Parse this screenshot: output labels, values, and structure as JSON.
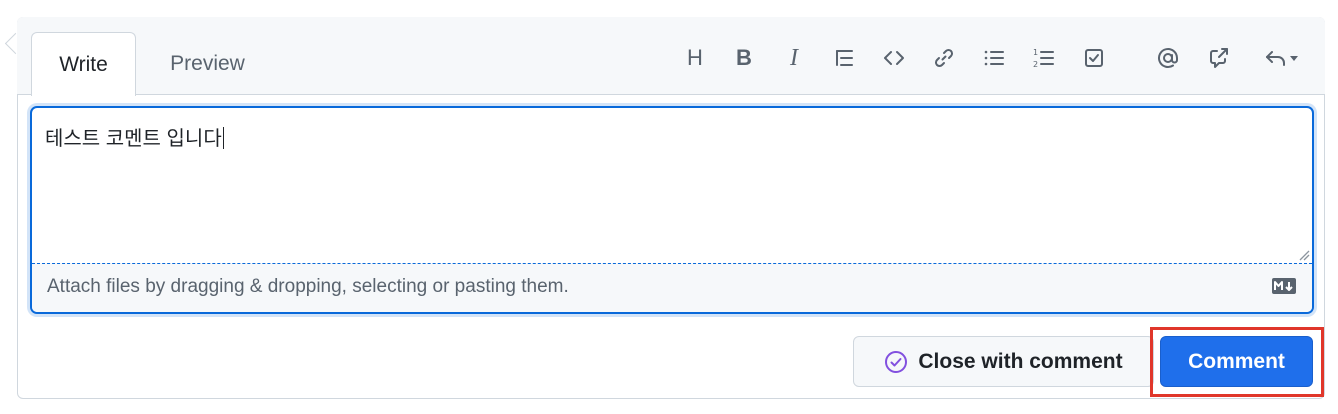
{
  "tabs": {
    "write": "Write",
    "preview": "Preview"
  },
  "toolbar": {
    "heading_glyph": "H",
    "bold_glyph": "B",
    "italic_glyph": "I",
    "items": [
      "heading-icon",
      "bold-icon",
      "italic-icon",
      "quote-icon",
      "code-icon",
      "link-icon",
      "unordered-list-icon",
      "ordered-list-icon",
      "task-list-icon",
      "mention-icon",
      "reference-icon",
      "reply-icon"
    ]
  },
  "editor": {
    "value": "테스트 코멘트 입니다",
    "attach_hint": "Attach files by dragging & dropping, selecting or pasting them."
  },
  "actions": {
    "close_label": "Close with comment",
    "comment_label": "Comment"
  },
  "colors": {
    "accent": "#0969da",
    "comment_button": "#1f6feb",
    "close_icon": "#8250df",
    "highlight": "#e0362a"
  }
}
